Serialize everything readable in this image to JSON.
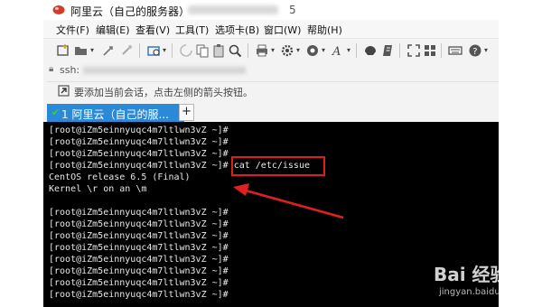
{
  "window": {
    "title": "阿里云（自己的服务器）",
    "title_suffix": "5"
  },
  "menu": {
    "items": [
      {
        "label": "文件(F)"
      },
      {
        "label": "编辑(E)"
      },
      {
        "label": "查看(V)"
      },
      {
        "label": "工具(T)"
      },
      {
        "label": "选项卡(B)"
      },
      {
        "label": "窗口(W)"
      },
      {
        "label": "帮助(H)"
      }
    ]
  },
  "toolbar": {
    "icons": [
      "new-session-icon",
      "open-folder-icon",
      "connect-icon",
      "quick-connect-icon",
      "disconnect-icon",
      "reconnect-icon",
      "copy-icon",
      "paste-icon",
      "find-icon",
      "print-icon",
      "settings-icon",
      "global-options-icon",
      "font-icon",
      "sftp-icon",
      "script-icon",
      "fullscreen-icon",
      "tile-icon",
      "keymap-icon",
      "help-icon"
    ]
  },
  "address": {
    "prefix": "ssh:"
  },
  "hint": {
    "text": "要添加当前会话，点击左侧的箭头按钮。"
  },
  "tab": {
    "status": "✔",
    "label": "1 阿里云（自己的服...",
    "add": "+"
  },
  "terminal": {
    "lines": [
      "[root@iZm5einnyuqc4m7ltlwn3vZ ~]#",
      "[root@iZm5einnyuqc4m7ltlwn3vZ ~]#",
      "[root@iZm5einnyuqc4m7ltlwn3vZ ~]#",
      "[root@iZm5einnyuqc4m7ltlwn3vZ ~]# cat /etc/issue",
      "CentOS release 6.5 (Final)",
      "Kernel \\r on an \\m",
      "",
      "[root@iZm5einnyuqc4m7ltlwn3vZ ~]#",
      "[root@iZm5einnyuqc4m7ltlwn3vZ ~]#",
      "[root@iZm5einnyuqc4m7ltlwn3vZ ~]#",
      "[root@iZm5einnyuqc4m7ltlwn3vZ ~]#",
      "[root@iZm5einnyuqc4m7ltlwn3vZ ~]#",
      "[root@iZm5einnyuqc4m7ltlwn3vZ ~]#",
      "[root@iZm5einnyuqc4m7ltlwn3vZ ~]#",
      "[root@iZm5einnyuqc4m7ltlwn3vZ ~]#"
    ],
    "highlight_color": "#e02020"
  },
  "watermark": {
    "logo": "Bai 经验",
    "url": "jingyan.baidu.com"
  },
  "colors": {
    "tab_active": "#2a8ad8",
    "terminal_bg": "#000000",
    "terminal_fg": "#e8e8e8",
    "annotation": "#e02020"
  }
}
